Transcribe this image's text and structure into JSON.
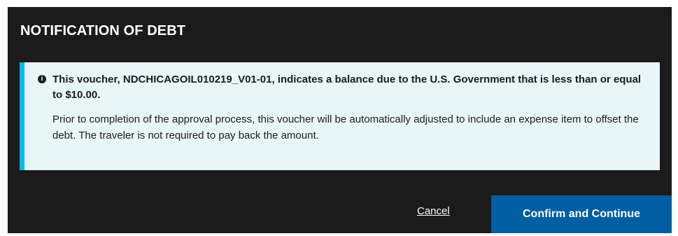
{
  "modal": {
    "title": "NOTIFICATION OF DEBT",
    "alert": {
      "icon": "info-circle-icon",
      "accent_color": "#00bde3",
      "background_color": "#e7f6f8",
      "icon_glyph": "i",
      "heading": "This voucher, NDCHICAGOIL010219_V01-01, indicates a balance due to the U.S. Government that is less than or equal to $10.00.",
      "body": "Prior to completion of the approval process, this voucher will be automatically adjusted to include an expense item to offset the debt. The traveler is not required to pay back the amount."
    },
    "footer": {
      "cancel_label": "Cancel",
      "confirm_label": "Confirm and Continue",
      "confirm_color": "#005ea2"
    }
  }
}
